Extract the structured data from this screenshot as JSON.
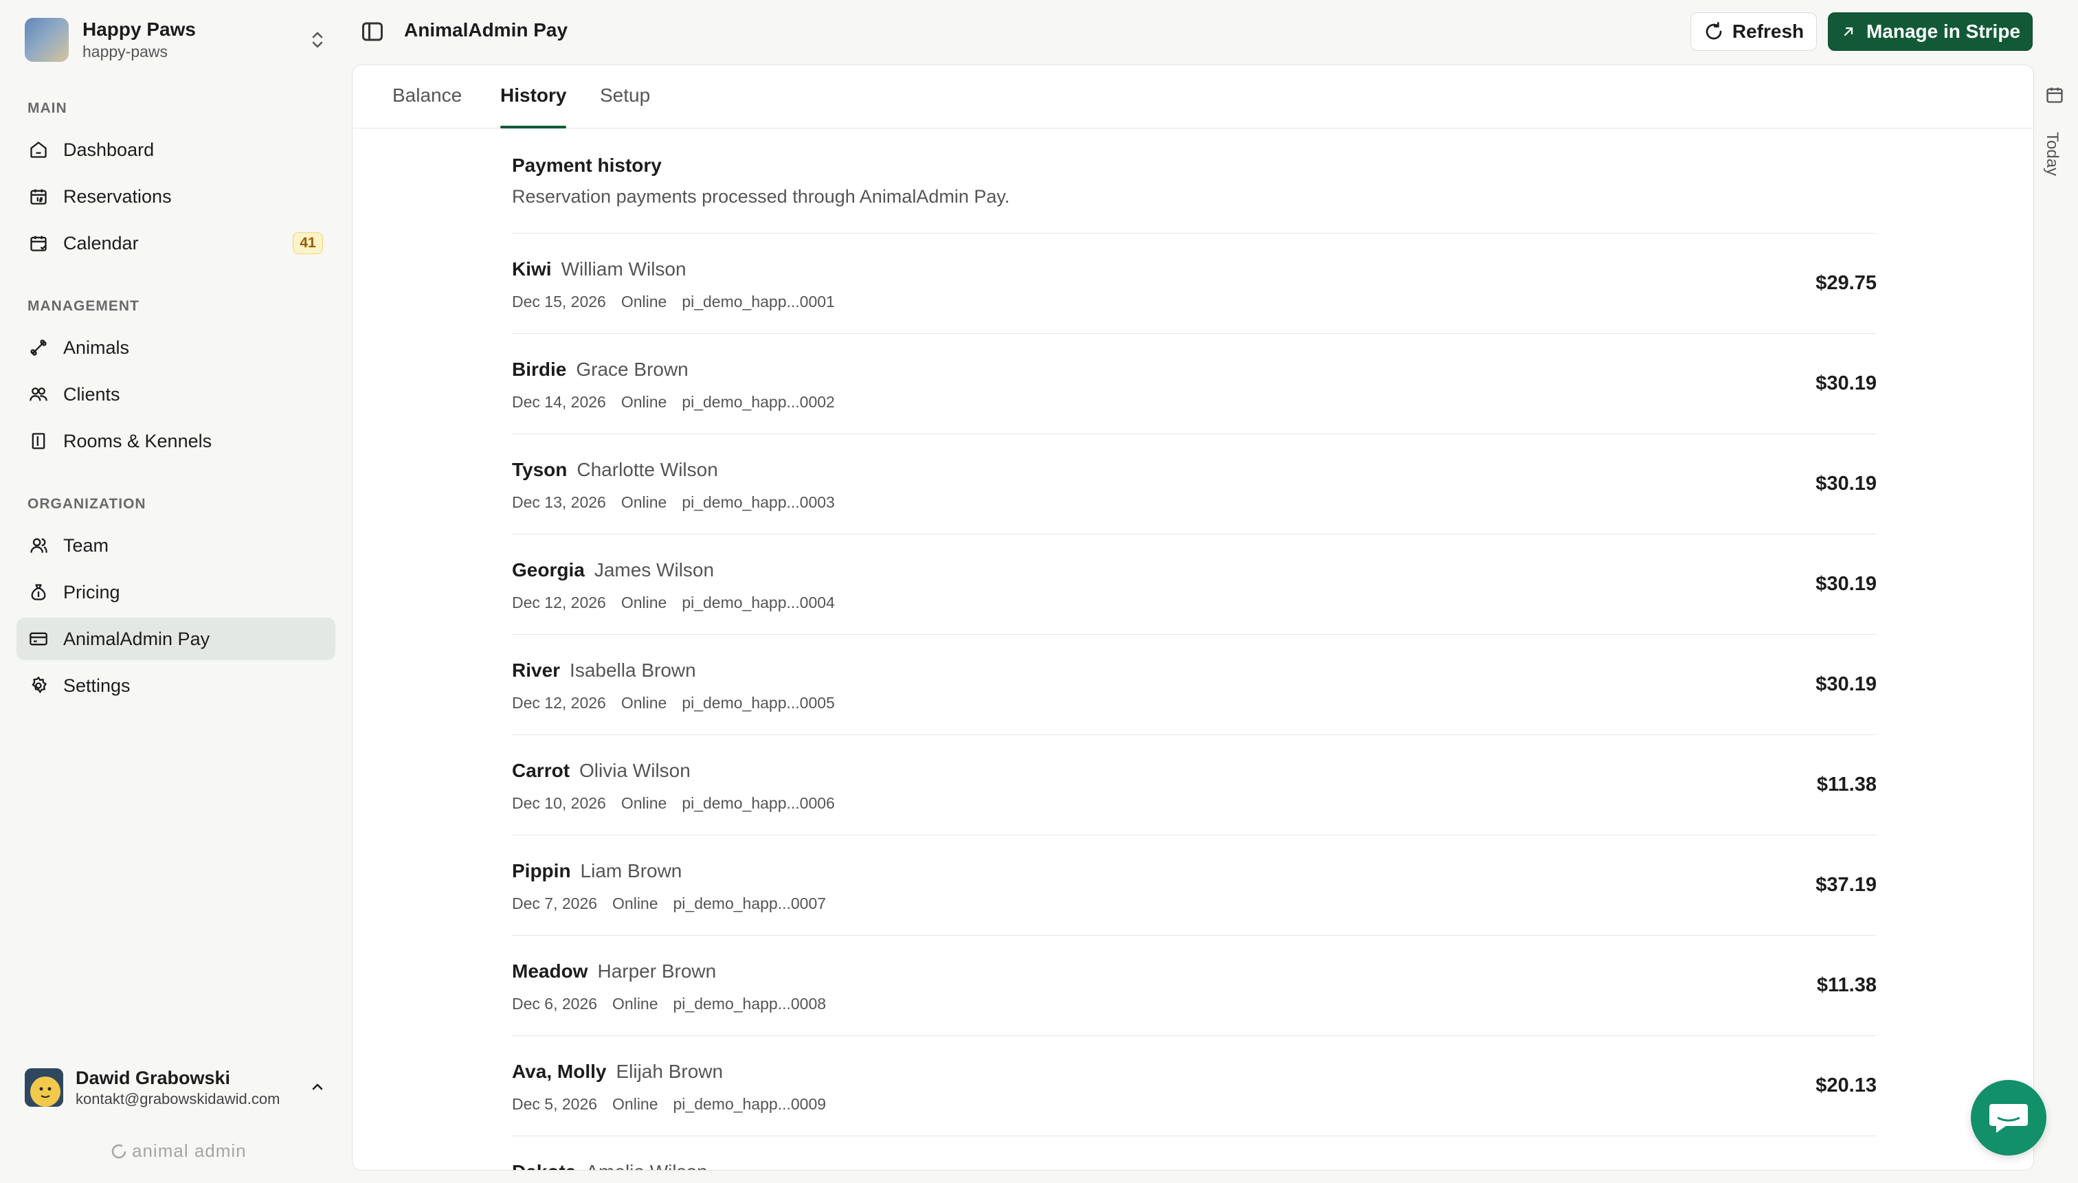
{
  "org": {
    "name": "Happy Paws",
    "slug": "happy-paws"
  },
  "nav": {
    "main_label": "MAIN",
    "management_label": "MANAGEMENT",
    "organization_label": "ORGANIZATION",
    "items": [
      {
        "label": "Dashboard",
        "icon": "home-icon"
      },
      {
        "label": "Reservations",
        "icon": "calendar-number-icon"
      },
      {
        "label": "Calendar",
        "icon": "calendar-icon",
        "badge": "41"
      },
      {
        "label": "Animals",
        "icon": "bone-icon"
      },
      {
        "label": "Clients",
        "icon": "users-icon"
      },
      {
        "label": "Rooms & Kennels",
        "icon": "door-icon"
      },
      {
        "label": "Team",
        "icon": "team-icon"
      },
      {
        "label": "Pricing",
        "icon": "money-bag-icon"
      },
      {
        "label": "AnimalAdmin Pay",
        "icon": "credit-card-icon",
        "active": true
      },
      {
        "label": "Settings",
        "icon": "gear-icon"
      }
    ]
  },
  "user": {
    "name": "Dawid Grabowski",
    "email": "kontakt@grabowskidawid.com"
  },
  "brand_footer": "animal admin",
  "topbar": {
    "title": "AnimalAdmin Pay",
    "refresh_label": "Refresh",
    "stripe_label": "Manage in Stripe"
  },
  "tabs": [
    "Balance",
    "History",
    "Setup"
  ],
  "active_tab": "History",
  "history": {
    "title": "Payment history",
    "subtitle": "Reservation payments processed through AnimalAdmin Pay.",
    "rows": [
      {
        "pet": "Kiwi",
        "owner": "William Wilson",
        "date": "Dec 15, 2026",
        "method": "Online",
        "id": "pi_demo_happ...0001",
        "amount": "$29.75"
      },
      {
        "pet": "Birdie",
        "owner": "Grace Brown",
        "date": "Dec 14, 2026",
        "method": "Online",
        "id": "pi_demo_happ...0002",
        "amount": "$30.19"
      },
      {
        "pet": "Tyson",
        "owner": "Charlotte Wilson",
        "date": "Dec 13, 2026",
        "method": "Online",
        "id": "pi_demo_happ...0003",
        "amount": "$30.19"
      },
      {
        "pet": "Georgia",
        "owner": "James Wilson",
        "date": "Dec 12, 2026",
        "method": "Online",
        "id": "pi_demo_happ...0004",
        "amount": "$30.19"
      },
      {
        "pet": "River",
        "owner": "Isabella Brown",
        "date": "Dec 12, 2026",
        "method": "Online",
        "id": "pi_demo_happ...0005",
        "amount": "$30.19"
      },
      {
        "pet": "Carrot",
        "owner": "Olivia Wilson",
        "date": "Dec 10, 2026",
        "method": "Online",
        "id": "pi_demo_happ...0006",
        "amount": "$11.38"
      },
      {
        "pet": "Pippin",
        "owner": "Liam Brown",
        "date": "Dec 7, 2026",
        "method": "Online",
        "id": "pi_demo_happ...0007",
        "amount": "$37.19"
      },
      {
        "pet": "Meadow",
        "owner": "Harper Brown",
        "date": "Dec 6, 2026",
        "method": "Online",
        "id": "pi_demo_happ...0008",
        "amount": "$11.38"
      },
      {
        "pet": "Ava, Molly",
        "owner": "Elijah Brown",
        "date": "Dec 5, 2026",
        "method": "Online",
        "id": "pi_demo_happ...0009",
        "amount": "$20.13"
      },
      {
        "pet": "Dakota",
        "owner": "Amelia Wilson",
        "date": "",
        "method": "",
        "id": "",
        "amount": ""
      }
    ]
  },
  "rail": {
    "today_label": "Today"
  },
  "colors": {
    "accent": "#125a37",
    "chat": "#12906a",
    "badge_bg": "#fdf2c8",
    "badge_text": "#9a5b00"
  }
}
